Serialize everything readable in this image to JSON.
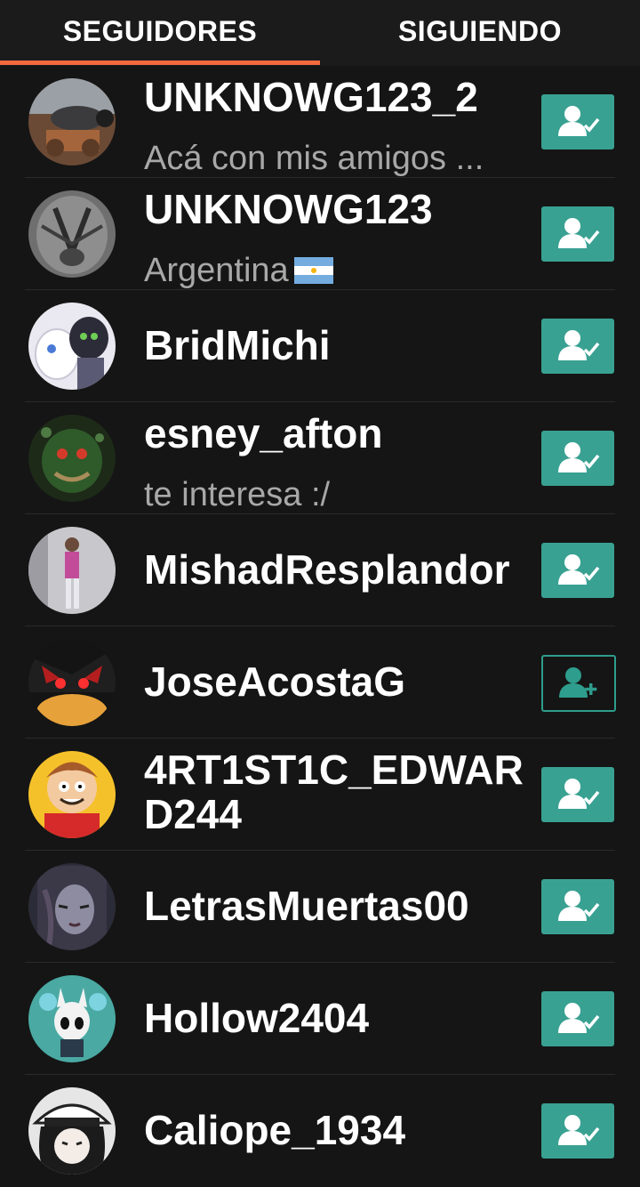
{
  "tabs": [
    {
      "label": "SEGUIDORES",
      "active": true
    },
    {
      "label": "SIGUIENDO",
      "active": false
    }
  ],
  "colors": {
    "accent_underline": "#f26a3d",
    "following_button": "#39a192",
    "follow_outline": "#2e9d8d",
    "bio_text": "#a8a8a8",
    "background": "#151515"
  },
  "users": [
    {
      "name": "UNKNOWG123_2",
      "bio": "Acá con mis amigos ...",
      "status": "following",
      "icon": "user-check-icon"
    },
    {
      "name": "UNKNOWG123",
      "bio": "Argentina",
      "bio_flag": "argentina-flag-icon",
      "status": "following",
      "icon": "user-check-icon"
    },
    {
      "name": "BridMichi",
      "bio": "",
      "status": "following",
      "icon": "user-check-icon"
    },
    {
      "name": "esney_afton",
      "bio": "te interesa :/",
      "status": "following",
      "icon": "user-check-icon"
    },
    {
      "name": "MishadResplandor",
      "bio": "",
      "status": "following",
      "icon": "user-check-icon"
    },
    {
      "name": "JoseAcostaG",
      "bio": "",
      "status": "not_following",
      "icon": "user-plus-icon"
    },
    {
      "name": "4RT1ST1C_EDWARD244",
      "bio": "",
      "status": "following",
      "icon": "user-check-icon"
    },
    {
      "name": "LetrasMuertas00",
      "bio": "",
      "status": "following",
      "icon": "user-check-icon"
    },
    {
      "name": "Hollow2404",
      "bio": "",
      "status": "following",
      "icon": "user-check-icon"
    },
    {
      "name": "Caliope_1934",
      "bio": "",
      "status": "following",
      "icon": "user-check-icon"
    }
  ]
}
